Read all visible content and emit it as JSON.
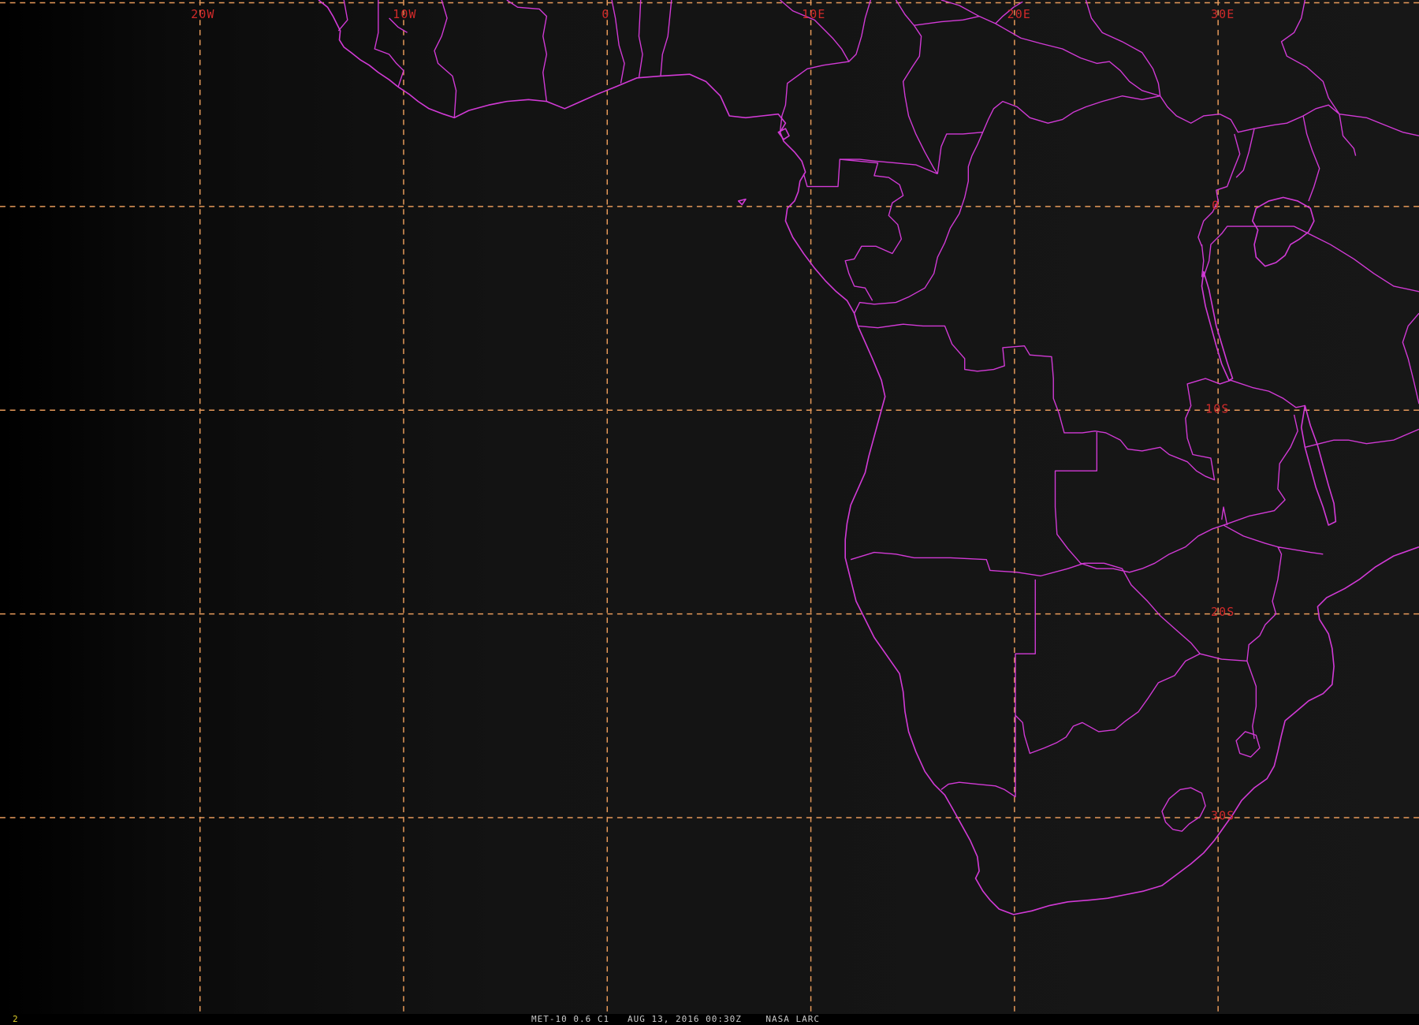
{
  "imagery": {
    "satellite": "MET-10",
    "channel": "0.6 C1",
    "date": "AUG 13, 2016",
    "time": "00:30Z",
    "source": "NASA LARC",
    "frame": "2"
  },
  "graticule": {
    "longitudes": [
      {
        "label": "20W",
        "value": -20
      },
      {
        "label": "10W",
        "value": -10
      },
      {
        "label": "0",
        "value": 0
      },
      {
        "label": "10E",
        "value": 10
      },
      {
        "label": "20E",
        "value": 20
      },
      {
        "label": "30E",
        "value": 30
      }
    ],
    "latitudes": [
      {
        "label": "0",
        "value": 0
      },
      {
        "label": "10S",
        "value": -10
      },
      {
        "label": "20S",
        "value": -20
      },
      {
        "label": "30S",
        "value": -30
      }
    ]
  },
  "colors": {
    "background_dark": "#000000",
    "background": "#151515",
    "coastline": "#d23ad6",
    "grid": "#e79a5a",
    "grid_label": "#d12a2a",
    "frame_number": "#e0d02a",
    "caption": "#c9c9c9"
  }
}
